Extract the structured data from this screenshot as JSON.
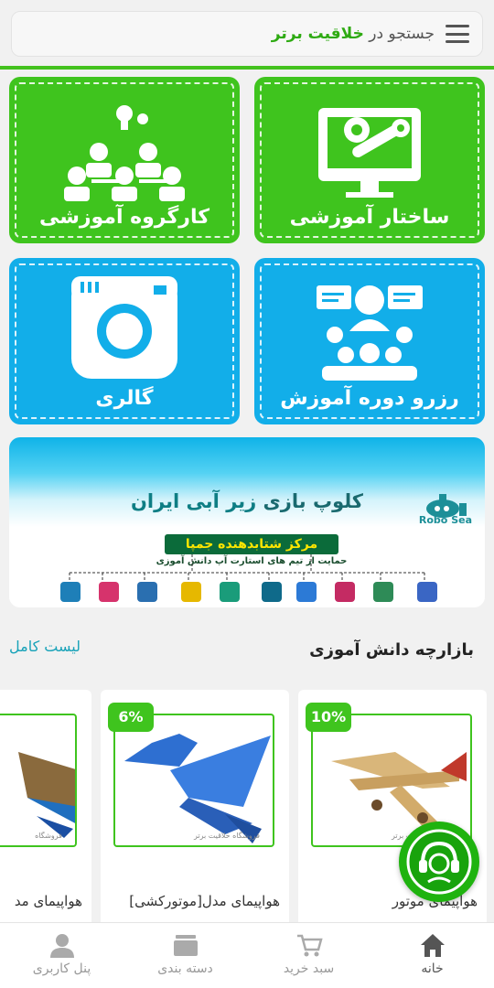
{
  "search": {
    "prefix": "جستجو در",
    "brand": "خلاقیت برتر"
  },
  "tiles": [
    {
      "label": "ساختار آموزشی",
      "icon": "monitor-gear-icon"
    },
    {
      "label": "کارگروه آموزشی",
      "icon": "team-idea-icon"
    },
    {
      "label": "رزرو دوره آموزش",
      "icon": "class-reservation-icon"
    },
    {
      "label": "گالری",
      "icon": "gallery-camera-icon"
    }
  ],
  "banner": {
    "title_main": "کلوپ بازی",
    "title_sub": "زیر آبی ایران",
    "logo_text": "Robo Sea",
    "center_title": "مرکز شتابدهنده جمپا",
    "center_subtitle": "حمایت از تیم های استارت آپ دانش آموزی"
  },
  "section": {
    "title": "بازارچه دانش آموزی",
    "see_all": "لیست کامل"
  },
  "products": [
    {
      "title": "هواپیمای موتور",
      "discount": "10%",
      "shop": "فروشگاه خلاقیت برتر"
    },
    {
      "title": "هواپیمای مدل[موتورکشی]",
      "discount": "6%",
      "shop": "فروشگاه خلاقیت برتر"
    },
    {
      "title": "هواپیمای مد",
      "shop": "فروشگاه"
    }
  ],
  "nav": [
    {
      "label": "خانه",
      "icon": "home-icon",
      "active": true
    },
    {
      "label": "سبد خرید",
      "icon": "cart-icon"
    },
    {
      "label": "دسته بندی",
      "icon": "category-icon"
    },
    {
      "label": "پنل کاربری",
      "icon": "user-icon"
    }
  ],
  "colors": {
    "green": "#3fc41e",
    "blue": "#12aee9",
    "link": "#17a2b8"
  }
}
